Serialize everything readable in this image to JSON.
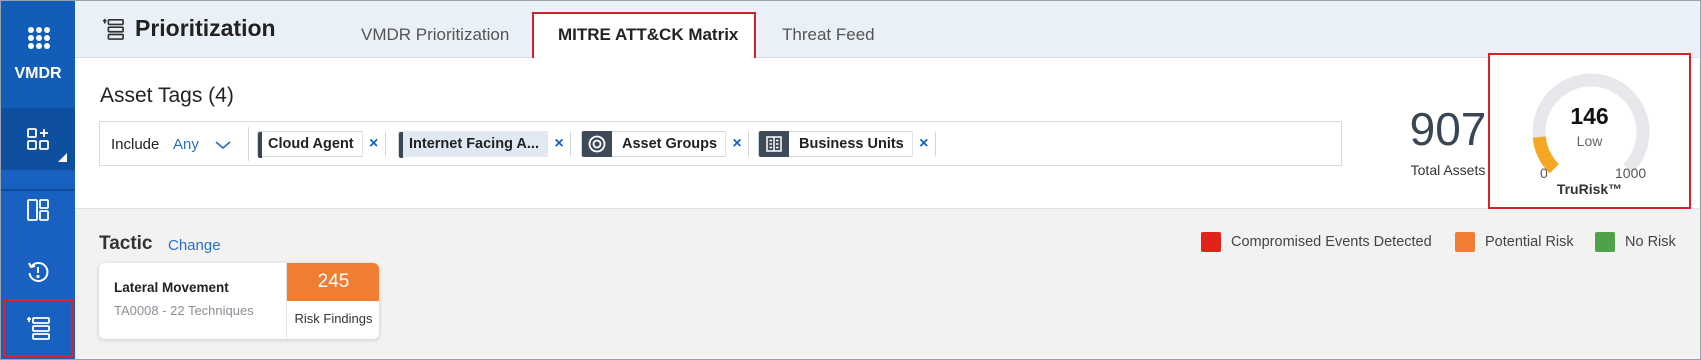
{
  "sidebar": {
    "app_name": "VMDR",
    "items": [
      {
        "icon": "dashboard-add-icon"
      },
      {
        "icon": "layout-icon"
      },
      {
        "icon": "history-icon"
      },
      {
        "icon": "prioritization-icon"
      }
    ]
  },
  "header": {
    "title": "Prioritization",
    "tabs": [
      {
        "label": "VMDR Prioritization",
        "active": false
      },
      {
        "label": "MITRE ATT&CK Matrix",
        "active": true
      },
      {
        "label": "Threat Feed",
        "active": false
      }
    ]
  },
  "assets": {
    "title": "Asset Tags (4)",
    "include_label": "Include",
    "include_value": "Any",
    "tags": [
      {
        "label": "Cloud Agent",
        "icon": "tag-icon"
      },
      {
        "label": "Internet Facing A...",
        "icon": "tag-icon"
      },
      {
        "label": "Asset Groups",
        "icon": "target-icon"
      },
      {
        "label": "Business Units",
        "icon": "building-icon"
      }
    ],
    "close_glyph": "×",
    "total_count": "907",
    "total_label": "Total Assets"
  },
  "trurisk": {
    "score": "146",
    "level": "Low",
    "min": "0",
    "max": "1000",
    "label": "TruRisk™",
    "score_fraction": 0.146
  },
  "tactic": {
    "title": "Tactic",
    "change_label": "Change",
    "legend": [
      {
        "label": "Compromised Events Detected",
        "color": "#e2231a"
      },
      {
        "label": "Potential Risk",
        "color": "#ef7d32"
      },
      {
        "label": "No Risk",
        "color": "#4ea24a"
      }
    ],
    "card": {
      "name": "Lateral Movement",
      "subtitle": "TA0008 - 22 Techniques",
      "count": "245",
      "count_label": "Risk Findings",
      "count_color": "#ef7d32"
    }
  }
}
